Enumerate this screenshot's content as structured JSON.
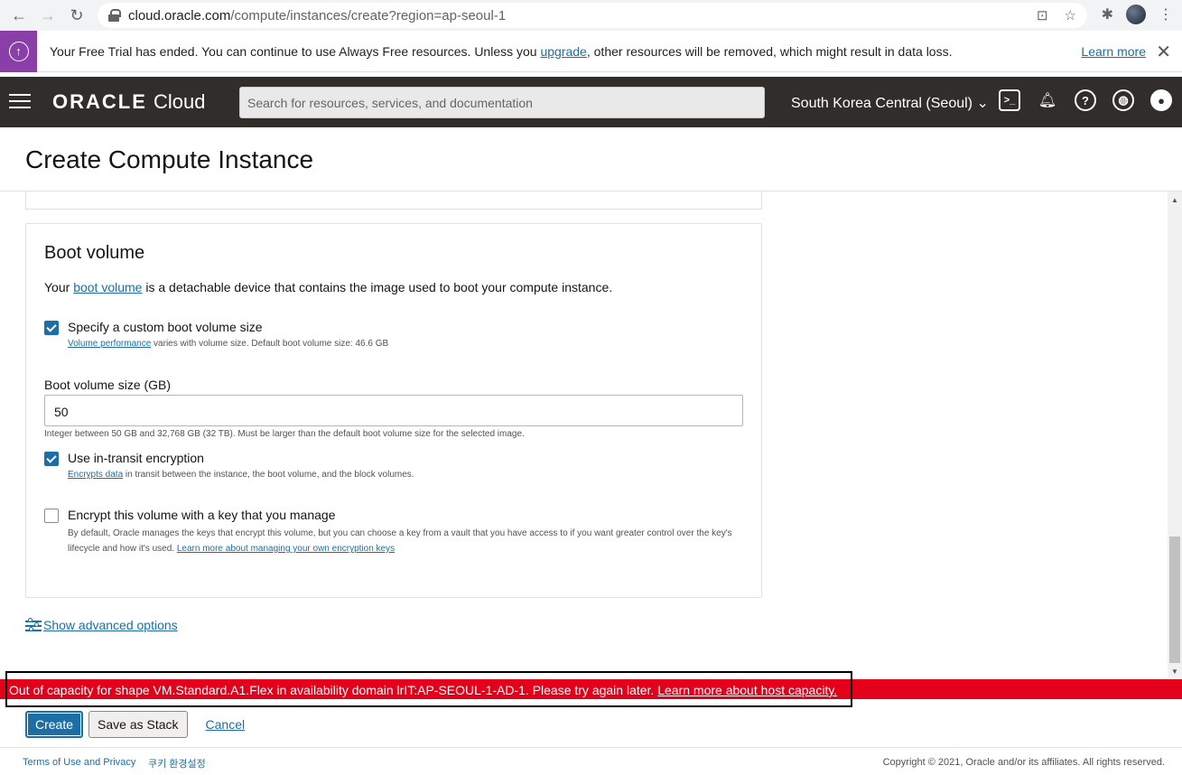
{
  "browser": {
    "url_host": "cloud.oracle.com",
    "url_path": "/compute/instances/create?region=ap-seoul-1"
  },
  "trial_banner": {
    "text_before": "Your Free Trial has ended. You can continue to use Always Free resources. Unless you ",
    "link": "upgrade",
    "text_after": ", other resources will be removed, which might result in data loss.",
    "learn_more": "Learn more"
  },
  "header": {
    "logo_brand": "ORACLE",
    "logo_product": "Cloud",
    "search_placeholder": "Search for resources, services, and documentation",
    "region": "South Korea Central (Seoul)"
  },
  "page": {
    "title": "Create Compute Instance"
  },
  "boot_volume": {
    "heading": "Boot volume",
    "desc_before": "Your ",
    "desc_link": "boot volume",
    "desc_after": " is a detachable device that contains the image used to boot your compute instance.",
    "custom_size": {
      "label": "Specify a custom boot volume size",
      "checked": true,
      "help_link": "Volume performance",
      "help_text": " varies with volume size. Default boot volume size: 46.6 GB"
    },
    "size_field": {
      "label": "Boot volume size (GB)",
      "value": "50",
      "help": "Integer between 50 GB and 32,768 GB (32 TB). Must be larger than the default boot volume size for the selected image."
    },
    "in_transit": {
      "label": "Use in-transit encryption",
      "checked": true,
      "help_link": "Encrypts data",
      "help_text": " in transit between the instance, the boot volume, and the block volumes."
    },
    "own_key": {
      "label": "Encrypt this volume with a key that you manage",
      "checked": false,
      "help_text": "By default, Oracle manages the keys that encrypt this volume, but you can choose a key from a vault that you have access to if you want greater control over the key's lifecycle and how it's used. ",
      "help_link": "Learn more about managing your own encryption keys"
    }
  },
  "advanced": {
    "label": "Show advanced options"
  },
  "error": {
    "text": "Out of capacity for shape VM.Standard.A1.Flex in availability domain lrIT:AP-SEOUL-1-AD-1. Please try again later. ",
    "link": "Learn more about host capacity."
  },
  "actions": {
    "create": "Create",
    "save_stack": "Save as Stack",
    "cancel": "Cancel"
  },
  "footer": {
    "terms": "Terms of Use and Privacy",
    "cookie": "쿠키 환경설정",
    "copyright": "Copyright © 2021, Oracle and/or its affiliates. All rights reserved."
  },
  "colors": {
    "brand_header": "#312d2a",
    "accent": "#1b6fa6",
    "error": "#e2001a",
    "trial_stripe": "#8a3fa8"
  }
}
